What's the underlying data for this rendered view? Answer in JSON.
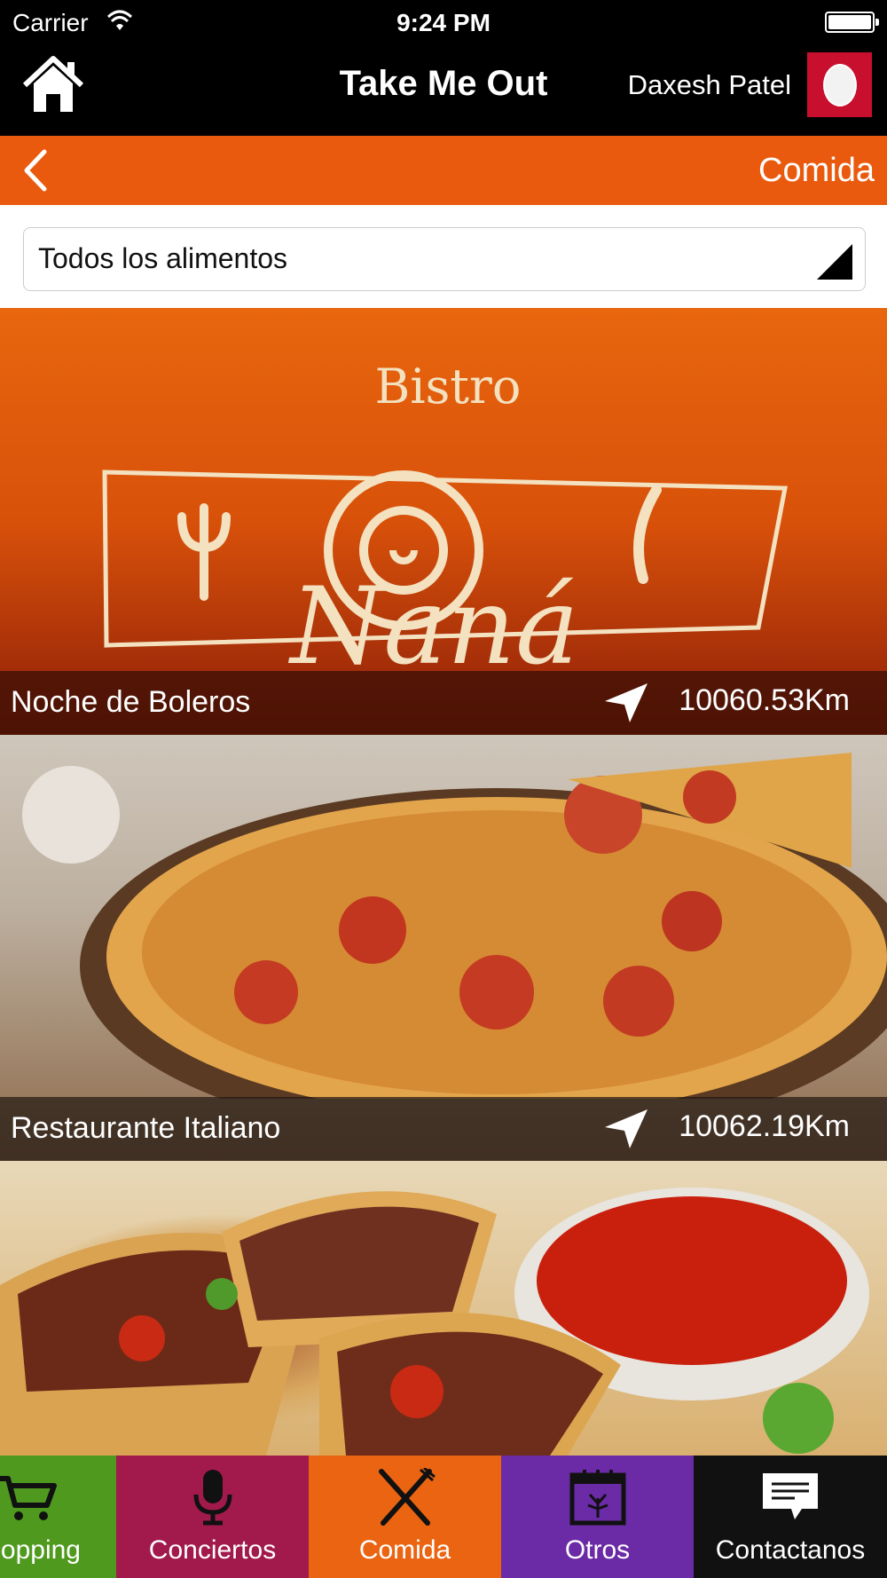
{
  "status_bar": {
    "carrier": "Carrier",
    "time": "9:24 PM"
  },
  "header": {
    "title": "Take Me Out",
    "user_name": "Daxesh Patel"
  },
  "section": {
    "title": "Comida"
  },
  "filter": {
    "selected": "Todos los alimentos"
  },
  "cards": [
    {
      "name": "Noche de Boleros",
      "distance": "10060.53Km",
      "logo_text_top": "Bistro",
      "logo_text_bottom": "Naná"
    },
    {
      "name": "Restaurante Italiano",
      "distance": "10062.19Km"
    },
    {
      "name": "",
      "distance": ""
    }
  ],
  "tabs": [
    {
      "label": "opping",
      "icon": "cart-icon",
      "color": "#4f9a1e"
    },
    {
      "label": "Conciertos",
      "icon": "microphone-icon",
      "color": "#a21a4b"
    },
    {
      "label": "Comida",
      "icon": "fork-knife-icon",
      "color": "#ea6412"
    },
    {
      "label": "Otros",
      "icon": "calendar-fireworks-icon",
      "color": "#6b2aa6"
    },
    {
      "label": "Contactanos",
      "icon": "message-icon",
      "color": "#111111"
    }
  ],
  "colors": {
    "accent": "#ea5a0e",
    "nav_bg": "#000000"
  }
}
